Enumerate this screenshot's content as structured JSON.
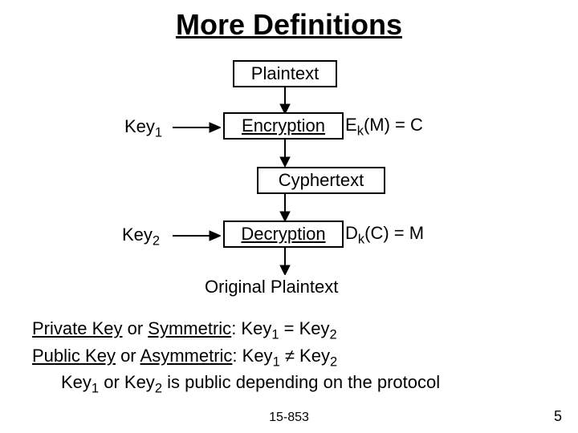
{
  "title": "More Definitions",
  "diagram": {
    "plaintext": "Plaintext",
    "key1": "Key",
    "key1_sub": "1",
    "encryption_label": "Encryption",
    "enc_formula_pre": "E",
    "enc_formula_sub": "k",
    "enc_formula_post": "(M) = C",
    "cyphertext": "Cyphertext",
    "key2": "Key",
    "key2_sub": "2",
    "decryption_label": "Decryption",
    "dec_formula_pre": "D",
    "dec_formula_sub": "k",
    "dec_formula_post": "(C) = M",
    "original_plaintext": "Original Plaintext"
  },
  "body": {
    "private_key_label": "Private Key",
    "or1": " or ",
    "symmetric_label": "Symmetric",
    "colon1": ": Key",
    "sub1a": "1",
    "eq": " = Key",
    "sub1b": "2",
    "public_key_label": "Public Key",
    "or2": " or ",
    "asymmetric_label": "Asymmetric",
    "colon2": ": Key",
    "sub2a": "1",
    "neq": " ≠ Key",
    "sub2b": "2",
    "line3_pre": "Key",
    "line3_sub1": "1",
    "line3_mid": " or Key",
    "line3_sub2": "2",
    "line3_post": " is public depending on the protocol"
  },
  "footer": {
    "center": "15-853",
    "right": "5"
  }
}
